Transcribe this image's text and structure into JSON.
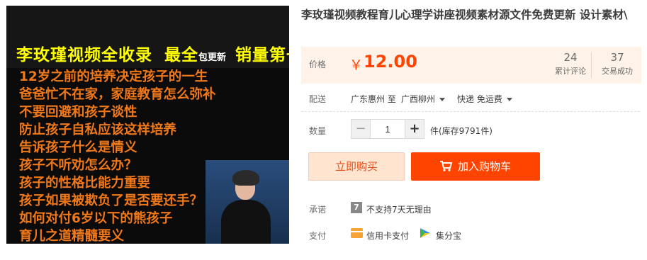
{
  "image": {
    "banner": {
      "main": "李玫瑾视频全收录",
      "best": "最全",
      "small": "包更新",
      "right": "销量第一"
    },
    "lines": [
      {
        "text": "12岁之前的培养决定孩子的一生",
        "color": "#f07818"
      },
      {
        "text": "爸爸忙不在家，家庭教育怎么弥补",
        "color": "#f07818"
      },
      {
        "text": "不要回避和孩子谈性",
        "color": "#f07818"
      },
      {
        "text": "防止孩子自私应该这样培养",
        "color": "#f07818"
      },
      {
        "text": "告诉孩子什么是情义",
        "color": "#f07818"
      },
      {
        "text": "孩子不听劝怎么办？",
        "color": "#f07818"
      },
      {
        "text": "孩子的性格比能力重要",
        "color": "#f07818"
      },
      {
        "text": "孩子如果被欺负了是否要还手？",
        "color": "#f07818"
      },
      {
        "text": "如何对付6岁以下的熊孩子",
        "color": "#f07818"
      },
      {
        "text": "育儿之道精髓要义",
        "color": "#f07818"
      }
    ]
  },
  "product": {
    "title": "李玫瑾视频教程育儿心理学讲座视频素材源文件免费更新 设计素材\\"
  },
  "price": {
    "label": "价格",
    "symbol": "￥",
    "value": "12.00",
    "reviews_count": "24",
    "reviews_label": "累计评论",
    "sales_count": "37",
    "sales_label": "交易成功"
  },
  "shipping": {
    "label": "配送",
    "from": "广东惠州 至",
    "to": "广西柳州",
    "method": "快递 免运费"
  },
  "quantity": {
    "label": "数量",
    "minus": "−",
    "value": "1",
    "plus": "+",
    "stock": "件(库存9791件)"
  },
  "actions": {
    "buy_now": "立即购买",
    "add_to_cart": "加入购物车"
  },
  "promise": {
    "label": "承诺",
    "badge": "7",
    "text": "不支持7天无理由"
  },
  "payment": {
    "label": "支付",
    "credit_card": "信用卡支付",
    "jifenbao": "集分宝"
  },
  "colors": {
    "accent": "#ff4400",
    "price_bg": "#fff2e8",
    "line_text": "#f07818"
  }
}
